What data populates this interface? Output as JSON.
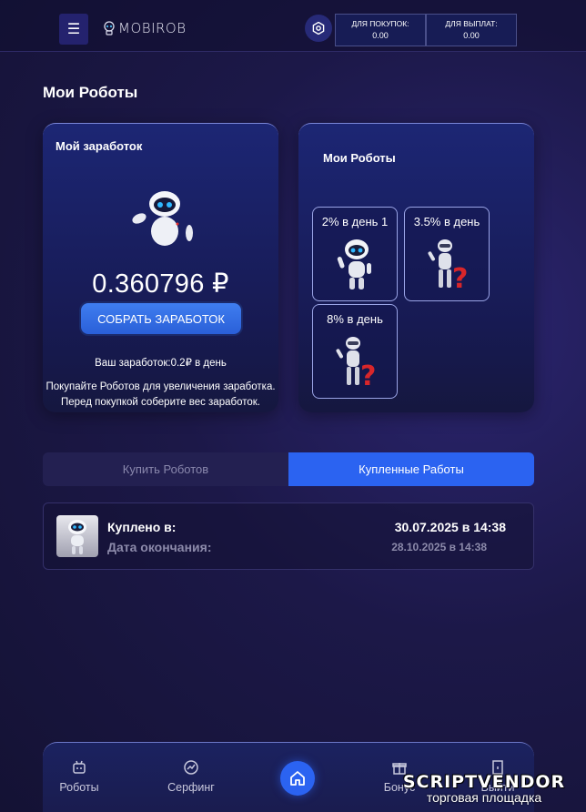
{
  "header": {
    "logo_text": "MOBIROB",
    "balances": [
      {
        "label": "ДЛЯ ПОКУПОК:",
        "value": "0.00"
      },
      {
        "label": "ДЛЯ ВЫПЛАТ:",
        "value": "0.00"
      }
    ]
  },
  "page_title": "Мои Роботы",
  "earnings_card": {
    "title": "Мой заработок",
    "amount": "0.360796 ₽",
    "collect_label": "СОБРАТЬ ЗАРАБОТОК",
    "rate_text": "Ваш заработок:0.2₽ в день",
    "note_line1": "Покупайте Роботов для увеличения заработка.",
    "note_line2": "Перед покупкой соберите вес заработок."
  },
  "robots_card": {
    "title": "Мои Роботы",
    "robots": [
      {
        "label": "2% в день 1"
      },
      {
        "label": "3.5% в день"
      },
      {
        "label": "8% в день"
      }
    ]
  },
  "tabs": [
    {
      "label": "Купить Роботов"
    },
    {
      "label": "Купленные Работы"
    }
  ],
  "purchase": {
    "bought_label": "Куплено в:",
    "end_label": "Дата окончания:",
    "bought_date": "30.07.2025 в 14:38",
    "end_date": "28.10.2025 в 14:38"
  },
  "bottom_nav": [
    {
      "label": "Роботы",
      "icon": "robot-icon"
    },
    {
      "label": "Серфинг",
      "icon": "trend-icon"
    },
    {
      "label": "",
      "icon": "home-icon"
    },
    {
      "label": "Бонус",
      "icon": "gift-icon"
    },
    {
      "label": "Выйти",
      "icon": "exit-icon"
    }
  ],
  "watermark": {
    "title": "SCRIPTVENDOR",
    "subtitle": "торговая площадка"
  },
  "colors": {
    "accent": "#2b63f1",
    "background": "#1c1848",
    "card": "#1c2674"
  }
}
